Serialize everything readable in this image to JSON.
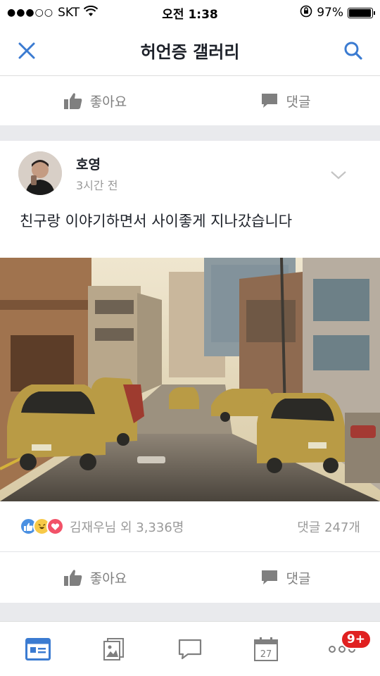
{
  "status": {
    "carrier": "SKT",
    "time": "오전 1:38",
    "battery": "97%",
    "battery_level": 0.97
  },
  "nav": {
    "title": "허언증 갤러리"
  },
  "prev_post_actions": {
    "like_label": "좋아요",
    "comment_label": "댓글"
  },
  "post": {
    "author": "호영",
    "time": "3시간 전",
    "text": "친구랑 이야기하면서 사이좋게 지나갔습니다",
    "reactions_text": "김재우님 외 3,336명",
    "comments_count": "댓글 247개",
    "actions": {
      "like_label": "좋아요",
      "comment_label": "댓글"
    }
  },
  "tabs": {
    "calendar_day": "27",
    "more_badge": "9+"
  },
  "colors": {
    "accent": "#3b7bd1",
    "like_blue": "#4a90e2",
    "love_red": "#f25268",
    "haha_yellow": "#f7c948",
    "badge_red": "#e02020"
  }
}
